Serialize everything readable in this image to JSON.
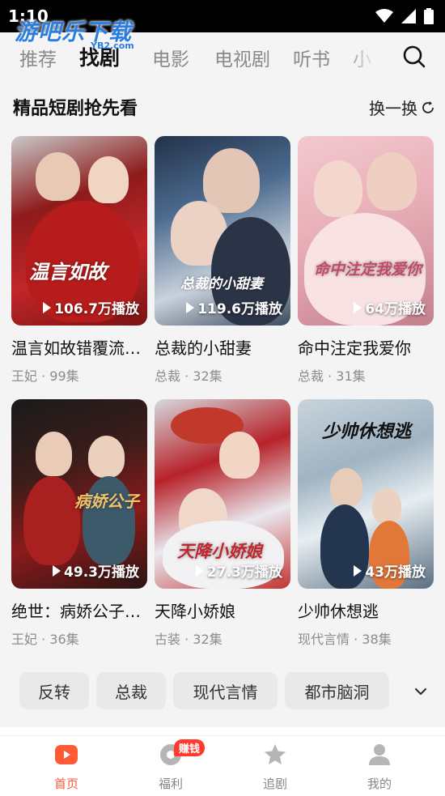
{
  "status_bar": {
    "time": "1:10"
  },
  "watermark": {
    "text": "游吧乐下载",
    "sub": "YB2.com"
  },
  "top_tabs": {
    "items": [
      {
        "label": "推荐",
        "active": false
      },
      {
        "label": "找剧",
        "active": true
      },
      {
        "label": "电影",
        "active": false
      },
      {
        "label": "电视剧",
        "active": false
      },
      {
        "label": "听书",
        "active": false
      },
      {
        "label": "小",
        "active": false
      }
    ]
  },
  "section": {
    "title": "精品短剧抢先看",
    "refresh_label": "换一换"
  },
  "cards": [
    {
      "title": "温言如故错覆流…",
      "meta": "王妃 · 99集",
      "plays": "106.7万播放",
      "poster_text": "温言如故"
    },
    {
      "title": "总裁的小甜妻",
      "meta": "总裁 · 32集",
      "plays": "119.6万播放",
      "poster_text": "总裁的小甜妻"
    },
    {
      "title": "命中注定我爱你",
      "meta": "总裁 · 31集",
      "plays": "64万播放",
      "poster_text": "命中注定我爱你"
    },
    {
      "title": "绝世：病娇公子…",
      "meta": "王妃 · 36集",
      "plays": "49.3万播放",
      "poster_text": "病娇公子"
    },
    {
      "title": "天降小娇娘",
      "meta": "古装 · 32集",
      "plays": "27.3万播放",
      "poster_text": "天降小娇娘"
    },
    {
      "title": "少帅休想逃",
      "meta": "现代言情 · 38集",
      "plays": "43万播放",
      "poster_text": "少帅休想逃"
    }
  ],
  "tags": [
    "反转",
    "总裁",
    "现代言情",
    "都市脑洞"
  ],
  "bottom_nav": {
    "items": [
      {
        "label": "首页",
        "icon": "home-icon",
        "active": true
      },
      {
        "label": "福利",
        "icon": "coin-icon",
        "active": false,
        "badge": "赚钱"
      },
      {
        "label": "追剧",
        "icon": "star-icon",
        "active": false
      },
      {
        "label": "我的",
        "icon": "user-icon",
        "active": false
      }
    ]
  },
  "colors": {
    "accent": "#ff5a36",
    "badge": "#ff3b30",
    "watermark": "#2a7de1",
    "background": "#f4f4f4"
  }
}
